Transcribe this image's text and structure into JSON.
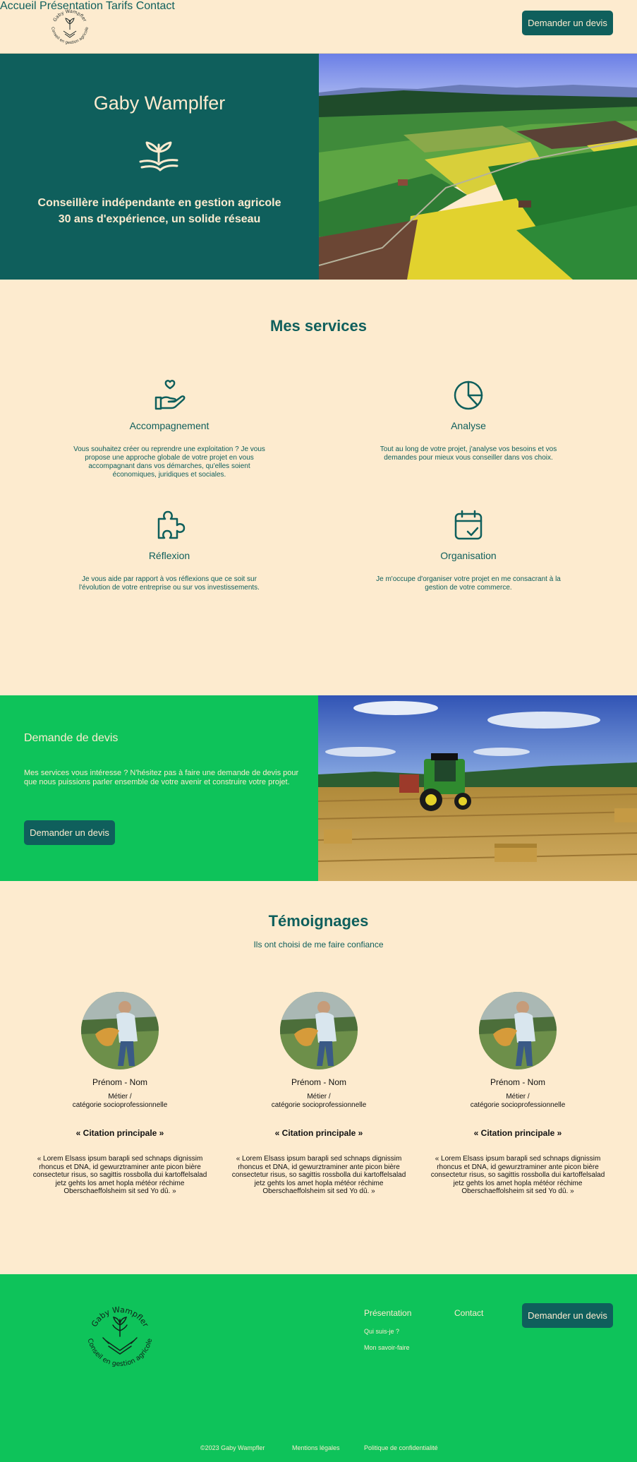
{
  "header": {
    "logo_text_top": "Gaby Wampfler",
    "logo_text_bottom": "Conseil en gestion agricole",
    "nav": [
      "Accueil",
      "Présentation",
      "Tarifs",
      "Contact"
    ],
    "cta": "Demander un devis"
  },
  "hero": {
    "title": "Gaby Wamplfer",
    "subtitle_line1": "Conseillère indépendante en gestion agricole",
    "subtitle_line2": "30 ans d'expérience, un solide réseau",
    "image": "aerial-farmland-fields-photo"
  },
  "services": {
    "title": "Mes services",
    "items": [
      {
        "icon": "hand-heart-icon",
        "title": "Accompagnement",
        "desc": "Vous souhaitez créer ou reprendre une exploitation ? Je vous propose une approche globale de votre projet en vous accompagnant dans vos démarches, qu'elles soient économiques, juridiques et sociales."
      },
      {
        "icon": "pie-chart-icon",
        "title": "Analyse",
        "desc": "Tout au long de votre projet, j'analyse vos besoins et vos demandes pour mieux vous conseiller dans vos choix."
      },
      {
        "icon": "puzzle-icon",
        "title": "Réflexion",
        "desc": "Je vous aide par rapport à vos réflexions que ce soit sur l'évolution de votre entreprise ou sur vos investissements."
      },
      {
        "icon": "calendar-check-icon",
        "title": "Organisation",
        "desc": "Je m'occupe d'organiser votre projet en me consacrant à la gestion de votre commerce."
      }
    ]
  },
  "quote_request": {
    "title": "Demande de devis",
    "text": "Mes services vous intéresse ? N'hésitez pas à faire une demande de devis pour que nous puissions parler ensemble de votre avenir et construire votre projet.",
    "cta": "Demander un devis",
    "image": "tractor-hay-field-photo"
  },
  "testimonials": {
    "title": "Témoignages",
    "subtitle": "Ils ont choisi de me faire confiance",
    "items": [
      {
        "name": "Prénom - Nom",
        "job_line1": "Métier /",
        "job_line2": "catégorie socioprofessionnelle",
        "quote": "« Citation principale »",
        "text": "« Lorem Elsass ipsum barapli sed schnaps dignissim rhoncus et DNA, id gewurztraminer ante picon bière consectetur risus, so sagittis rossbolla dui kartoffelsalad jetz gehts los amet hopla météor réchime Oberschaeffolsheim sit sed Yo dû. »"
      },
      {
        "name": "Prénom - Nom",
        "job_line1": "Métier /",
        "job_line2": "catégorie socioprofessionnelle",
        "quote": "« Citation principale »",
        "text": "« Lorem Elsass ipsum barapli sed schnaps dignissim rhoncus et DNA, id gewurztraminer ante picon bière consectetur risus, so sagittis rossbolla dui kartoffelsalad jetz gehts los amet hopla météor réchime Oberschaeffolsheim sit sed Yo dû. »"
      },
      {
        "name": "Prénom - Nom",
        "job_line1": "Métier /",
        "job_line2": "catégorie socioprofessionnelle",
        "quote": "« Citation principale »",
        "text": "« Lorem Elsass ipsum barapli sed schnaps dignissim rhoncus et DNA, id gewurztraminer ante picon bière consectetur risus, so sagittis rossbolla dui kartoffelsalad jetz gehts los amet hopla météor réchime Oberschaeffolsheim sit sed Yo dû. »"
      }
    ]
  },
  "footer": {
    "logo_text_top": "Gaby Wampfler",
    "logo_text_bottom": "Conseil en gestion agricole",
    "presentation": "Présentation",
    "who_am_i": "Qui suis-je ?",
    "know_how": "Mon savoir-faire",
    "contact": "Contact",
    "cta": "Demander un devis",
    "copyright": "©2023 Gaby Wampfler",
    "legal": "Mentions légales",
    "privacy": "Politique de confidentialité"
  },
  "colors": {
    "cream": "#fdebcf",
    "teal": "#0f5f5c",
    "green": "#0ec35a"
  }
}
